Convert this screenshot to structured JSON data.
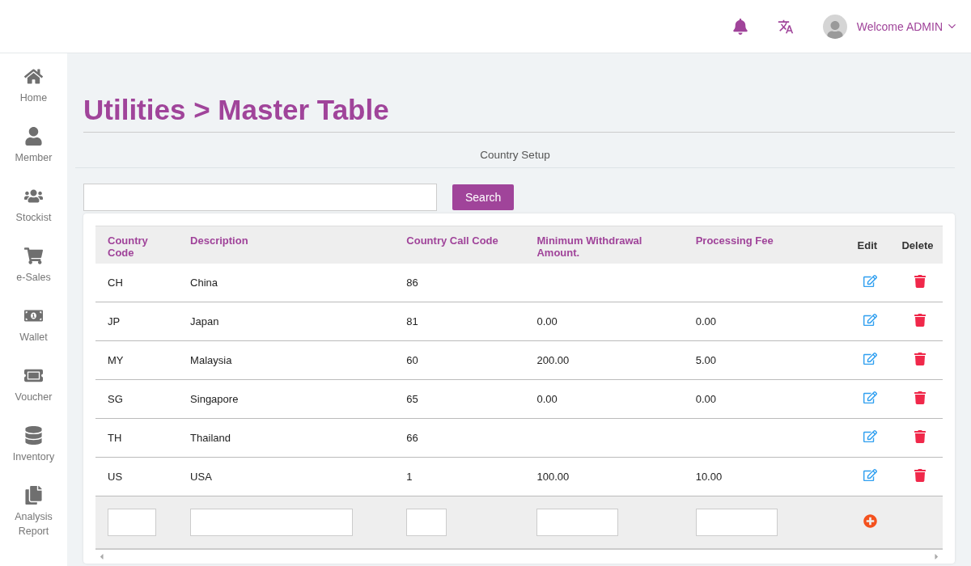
{
  "header": {
    "user_label": "Welcome ADMIN"
  },
  "sidebar": {
    "items": [
      {
        "label": "Home"
      },
      {
        "label": "Member"
      },
      {
        "label": "Stockist"
      },
      {
        "label": "e-Sales"
      },
      {
        "label": "Wallet"
      },
      {
        "label": "Voucher"
      },
      {
        "label": "Inventory"
      },
      {
        "label": "Analysis Report"
      }
    ]
  },
  "page_title": "Utilities > Master Table",
  "section_title": "Country Setup",
  "search": {
    "button": "Search"
  },
  "table": {
    "columns": [
      "Country Code",
      "Description",
      "Country Call Code",
      "Minimum Withdrawal Amount.",
      "Processing Fee",
      "Edit",
      "Delete"
    ],
    "rows": [
      [
        "CH",
        "China",
        "86",
        "",
        ""
      ],
      [
        "JP",
        "Japan",
        "81",
        "0.00",
        "0.00"
      ],
      [
        "MY",
        "Malaysia",
        "60",
        "200.00",
        "5.00"
      ],
      [
        "SG",
        "Singapore",
        "65",
        "0.00",
        "0.00"
      ],
      [
        "TH",
        "Thailand",
        "66",
        "",
        ""
      ],
      [
        "US",
        "USA",
        "1",
        "100.00",
        "10.00"
      ]
    ]
  }
}
